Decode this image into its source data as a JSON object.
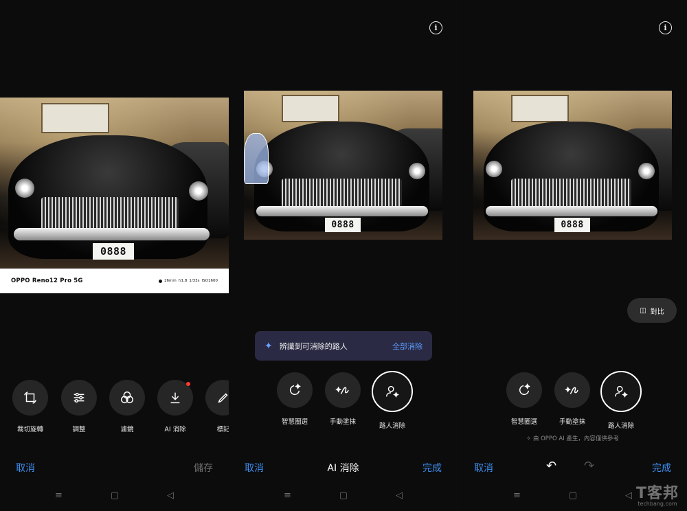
{
  "panel1": {
    "watermark": {
      "model": "OPPO Reno12 Pro 5G",
      "params": [
        "26mm",
        "f/1.8",
        "1/33s",
        "ISO1600"
      ]
    },
    "plate_text": "0888",
    "tools": [
      {
        "label": "裁切旋轉",
        "icon": "crop-rotate-icon"
      },
      {
        "label": "調整",
        "icon": "sliders-icon"
      },
      {
        "label": "濾鏡",
        "icon": "filter-circles-icon"
      },
      {
        "label": "AI 消除",
        "icon": "download-arrow-icon"
      },
      {
        "label": "標記",
        "icon": "pen-icon"
      }
    ],
    "cancel": "取消",
    "save": "儲存"
  },
  "panel2": {
    "info_icon": "i",
    "plate_text": "0888",
    "toast": {
      "message": "辨識到可消除的路人",
      "action": "全部消除"
    },
    "tools": [
      {
        "label": "智慧圈選",
        "icon": "smart-lasso-icon"
      },
      {
        "label": "手動塗抹",
        "icon": "brush-stroke-icon"
      },
      {
        "label": "路人消除",
        "icon": "person-remove-icon"
      }
    ],
    "cancel": "取消",
    "title": "AI 消除",
    "done": "完成"
  },
  "panel3": {
    "info_icon": "i",
    "plate_text": "0888",
    "compare": "對比",
    "tools": [
      {
        "label": "智慧圈選",
        "icon": "smart-lasso-icon"
      },
      {
        "label": "手動塗抹",
        "icon": "brush-stroke-icon"
      },
      {
        "label": "路人消除",
        "icon": "person-remove-icon"
      }
    ],
    "ai_note": "由 OPPO AI 產生，內容僅供參考",
    "cancel": "取消",
    "done": "完成"
  },
  "nav_icons": [
    "≡",
    "▢",
    "◁"
  ],
  "brand": {
    "name": "T客邦",
    "site": "techbang.com"
  },
  "colors": {
    "accent_blue": "#3d8ef0",
    "toast_bg": "#2a2a44",
    "red_dot": "#ff3b30"
  }
}
